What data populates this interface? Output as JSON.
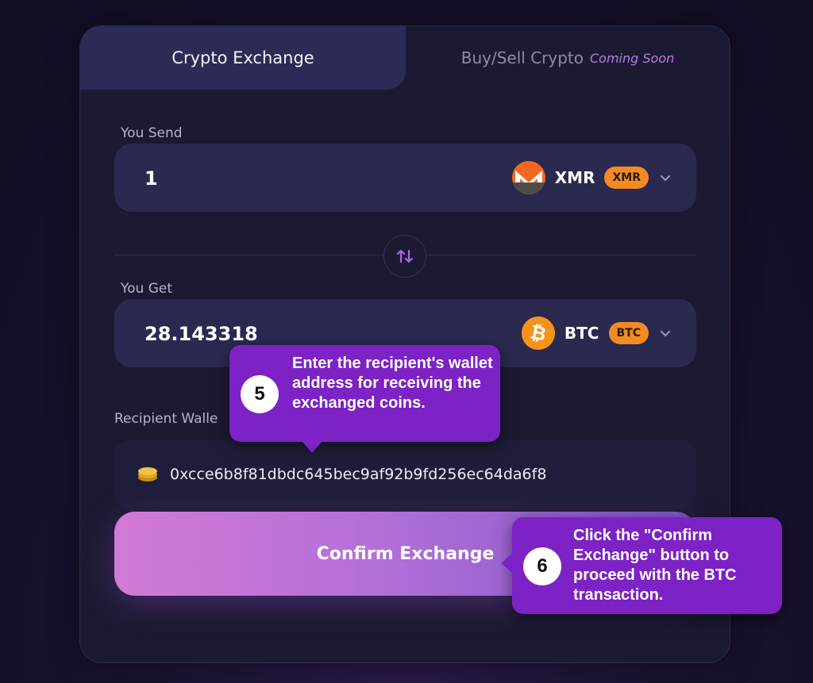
{
  "tabs": {
    "active": "Crypto Exchange",
    "inactive": "Buy/Sell Crypto",
    "inactive_badge": "Coming Soon"
  },
  "send": {
    "label": "You Send",
    "amount": "1",
    "coin_name": "XMR",
    "coin_badge": "XMR",
    "coin_color": "#f26822"
  },
  "get": {
    "label": "You Get",
    "amount": "28.143318",
    "coin_name": "BTC",
    "coin_badge": "BTC",
    "coin_color": "#f7931a"
  },
  "wallet": {
    "label": "Recipient Walle",
    "address": "0xcce6b8f81dbdc645bec9af92b9fd256ec64da6f8",
    "icon": "coins-icon"
  },
  "confirm": {
    "label": "Confirm Exchange"
  },
  "tooltips": [
    {
      "number": "5",
      "text": "Enter the recipient's wallet address for receiving the exchanged coins."
    },
    {
      "number": "6",
      "text": "Click the \"Confirm Exchange\" button to proceed with the BTC transaction."
    }
  ],
  "colors": {
    "accent_badge": "#f48a24",
    "tooltip_bg": "#7d22c4"
  }
}
